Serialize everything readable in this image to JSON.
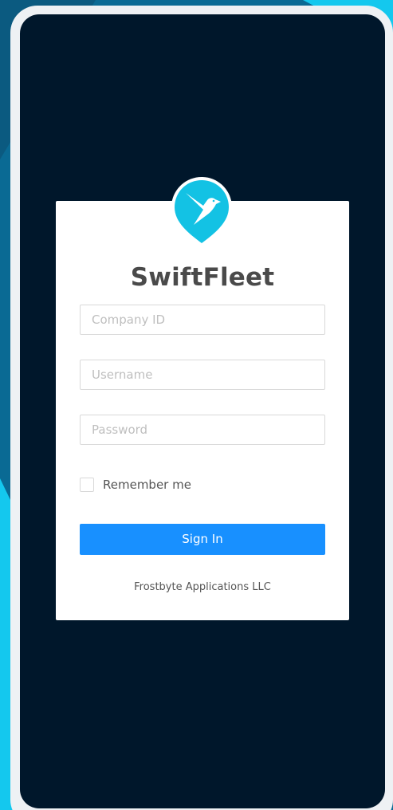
{
  "app": {
    "title": "SwiftFleet",
    "logo_icon": "bird-icon"
  },
  "form": {
    "company_id_placeholder": "Company ID",
    "company_id_value": "",
    "username_placeholder": "Username",
    "username_value": "",
    "password_placeholder": "Password",
    "password_value": "",
    "remember_label": "Remember me",
    "remember_checked": false,
    "signin_label": "Sign In"
  },
  "footer": {
    "company": "Frostbyte Applications LLC"
  },
  "colors": {
    "accent": "#1890ff",
    "screen_bg": "#00172b",
    "logo": "#13c2e4",
    "title": "#4a4a4a"
  }
}
